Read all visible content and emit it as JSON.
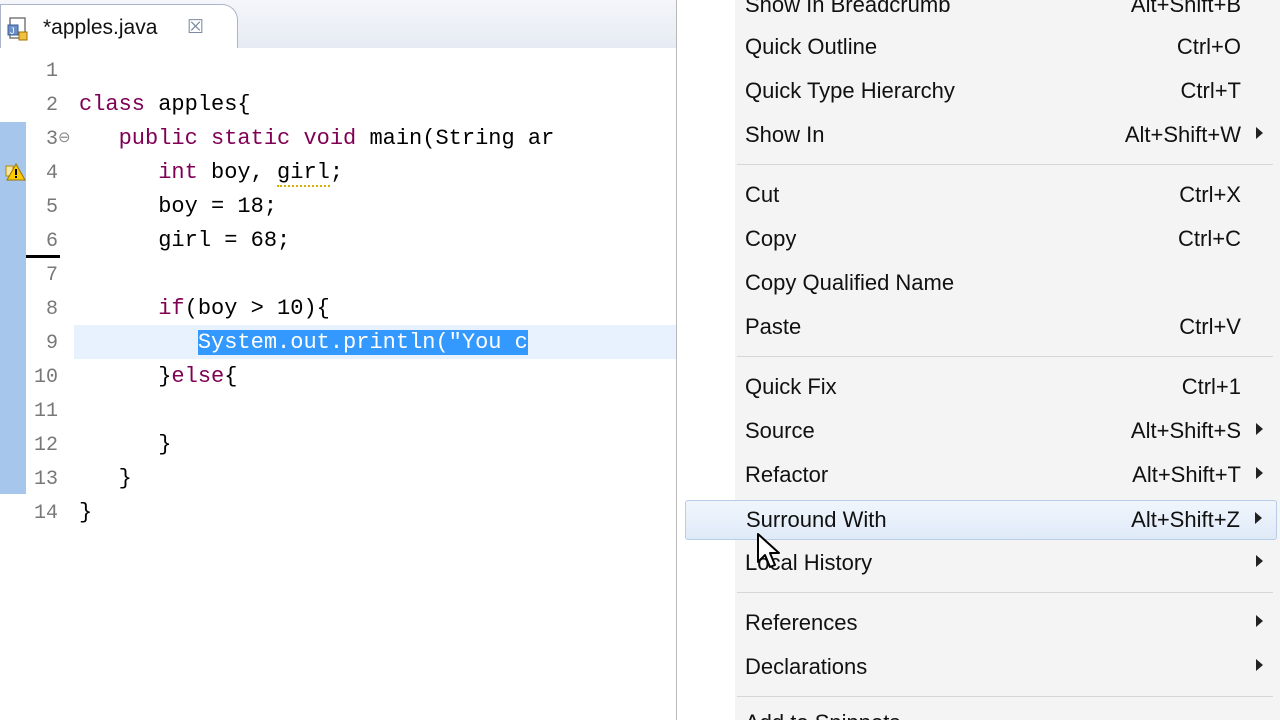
{
  "editor": {
    "tab": {
      "title": "*apples.java",
      "close_glyph": "☒",
      "icon": "java-file-icon"
    },
    "line_numbers": [
      "1",
      "2",
      "3",
      "4",
      "5",
      "6",
      "7",
      "8",
      "9",
      "10",
      "11",
      "12",
      "13",
      "14"
    ],
    "code": {
      "l2_kw": "class",
      "l2_rest": " apples{",
      "l3_indent": "   ",
      "l3_kw": "public static void",
      "l3_rest": " main(String ar",
      "l4_indent": "      ",
      "l4_kw": "int",
      "l4_rest1": " boy, ",
      "l4_warn": "girl",
      "l4_rest2": ";",
      "l5": "      boy = 18;",
      "l6": "      girl = 68;",
      "l8_indent": "      ",
      "l8_kw": "if",
      "l8_rest": "(boy > 10){",
      "l9_indent": "         ",
      "l9_sel": "System.out.println(\"You c",
      "l10_indent": "      ",
      "l10_rest1": "}",
      "l10_kw": "else",
      "l10_rest2": "{",
      "l12": "      }",
      "l13": "   }",
      "l14": "}"
    },
    "fold_glyph": "⊖"
  },
  "context_menu": {
    "items": [
      {
        "label": "Show In Breadcrumb",
        "accel": "Alt+Shift+B",
        "submenu": false
      },
      {
        "label": "Quick Outline",
        "accel": "Ctrl+O",
        "submenu": false
      },
      {
        "label": "Quick Type Hierarchy",
        "accel": "Ctrl+T",
        "submenu": false
      },
      {
        "label": "Show In",
        "accel": "Alt+Shift+W",
        "submenu": true
      },
      {
        "label": "Cut",
        "accel": "Ctrl+X",
        "submenu": false
      },
      {
        "label": "Copy",
        "accel": "Ctrl+C",
        "submenu": false
      },
      {
        "label": "Copy Qualified Name",
        "accel": "",
        "submenu": false
      },
      {
        "label": "Paste",
        "accel": "Ctrl+V",
        "submenu": false
      },
      {
        "label": "Quick Fix",
        "accel": "Ctrl+1",
        "submenu": false
      },
      {
        "label": "Source",
        "accel": "Alt+Shift+S",
        "submenu": true
      },
      {
        "label": "Refactor",
        "accel": "Alt+Shift+T",
        "submenu": true
      },
      {
        "label": "Surround With",
        "accel": "Alt+Shift+Z",
        "submenu": true
      },
      {
        "label": "Local History",
        "accel": "",
        "submenu": true
      },
      {
        "label": "References",
        "accel": "",
        "submenu": true
      },
      {
        "label": "Declarations",
        "accel": "",
        "submenu": true
      },
      {
        "label": "Add to Snippets...",
        "accel": "",
        "submenu": false
      }
    ],
    "highlighted": "Surround With"
  },
  "colors": {
    "keyword": "#7f0055",
    "selection": "#3399ff",
    "change_bar": "#a7c6ec",
    "menu_background": "#f4f4f4"
  }
}
